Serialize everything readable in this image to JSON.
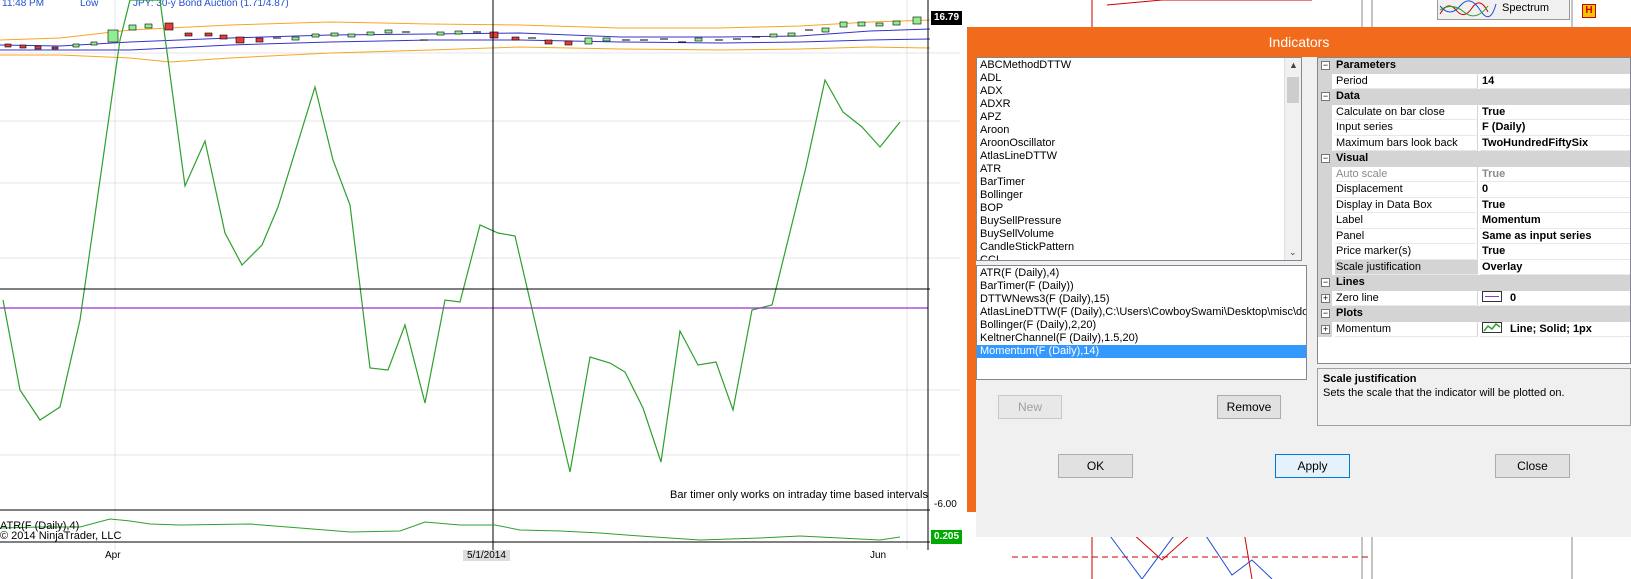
{
  "chart": {
    "top_left_time": "11:48 PM",
    "top_low_label": "Low",
    "top_event": "JPY: 30-y Bond Auction (1.71/4.87)",
    "price_box_top": "16.79",
    "price_box_mid": "-6.00",
    "price_box_atr": "0.205",
    "bar_timer_note": "Bar timer only works on intraday time based intervals",
    "atr_label": "ATR(F (Daily),4)",
    "copyright": "© 2014 NinjaTrader, LLC",
    "x_labels": [
      "Apr",
      "5/1/2014",
      "Jun"
    ],
    "colors": {
      "momentum": "#2ca02c",
      "zero_line": "#9b30c9",
      "keltner_outer": "#f5a623",
      "keltner_inner": "#3333cc",
      "bollinger": "#9a9a9a"
    }
  },
  "spectrum": {
    "label": "Spectrum",
    "badge": "H"
  },
  "dialog": {
    "title": "Indicators",
    "available_indicators": [
      "ABCMethodDTTW",
      "ADL",
      "ADX",
      "ADXR",
      "APZ",
      "Aroon",
      "AroonOscillator",
      "AtlasLineDTTW",
      "ATR",
      "BarTimer",
      "Bollinger",
      "BOP",
      "BuySellPressure",
      "BuySellVolume",
      "CandleStickPattern",
      "CCI"
    ],
    "applied_indicators": [
      "ATR(F (Daily),4)",
      "BarTimer(F (Daily))",
      "DTTWNews3(F (Daily),15)",
      "AtlasLineDTTW(F (Daily),C:\\Users\\CowboySwami\\Desktop\\misc\\doorb",
      "Bollinger(F (Daily),2,20)",
      "KeltnerChannel(F (Daily),1.5,20)",
      "Momentum(F (Daily),14)"
    ],
    "selected_applied_index": 6,
    "buttons": {
      "new": "New",
      "remove": "Remove",
      "ok": "OK",
      "apply": "Apply",
      "close": "Close"
    },
    "properties": {
      "parameters": {
        "label": "Parameters",
        "rows": [
          {
            "name": "Period",
            "value": "14"
          }
        ]
      },
      "data": {
        "label": "Data",
        "rows": [
          {
            "name": "Calculate on bar close",
            "value": "True"
          },
          {
            "name": "Input series",
            "value": "F (Daily)"
          },
          {
            "name": "Maximum bars look back",
            "value": "TwoHundredFiftySix"
          }
        ]
      },
      "visual": {
        "label": "Visual",
        "rows": [
          {
            "name": "Auto scale",
            "value": "True"
          },
          {
            "name": "Displacement",
            "value": "0"
          },
          {
            "name": "Display in Data Box",
            "value": "True"
          },
          {
            "name": "Label",
            "value": "Momentum"
          },
          {
            "name": "Panel",
            "value": "Same as input series"
          },
          {
            "name": "Price marker(s)",
            "value": "True"
          },
          {
            "name": "Scale justification",
            "value": "Overlay"
          }
        ]
      },
      "lines": {
        "label": "Lines",
        "rows": [
          {
            "name": "Zero line",
            "value": "0"
          }
        ]
      },
      "plots": {
        "label": "Plots",
        "rows": [
          {
            "name": "Momentum",
            "value": "Line; Solid; 1px"
          }
        ]
      }
    },
    "description": {
      "title": "Scale justification",
      "text": "Sets the scale that the indicator will be plotted on."
    }
  }
}
